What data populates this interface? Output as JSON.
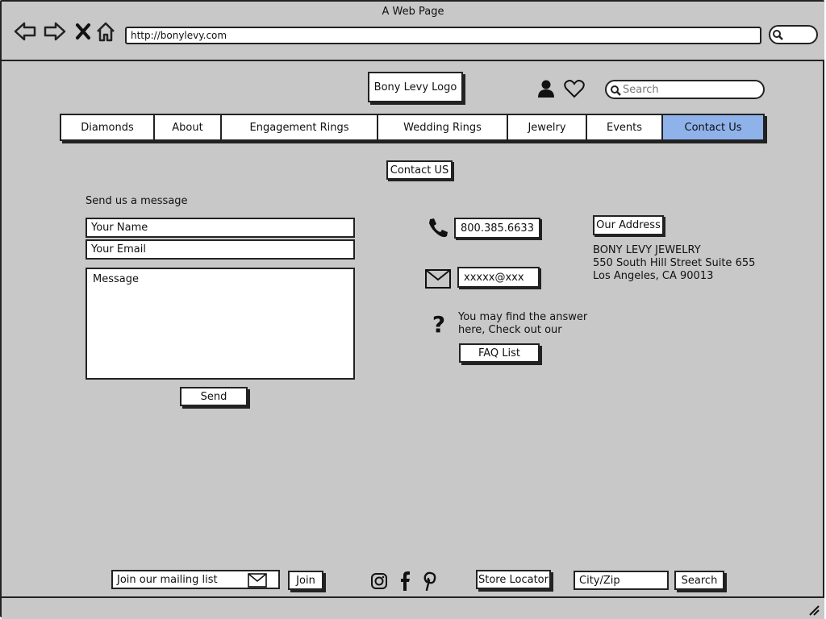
{
  "window": {
    "title": "A Web Page"
  },
  "browser": {
    "url": "http://bonylevy.com"
  },
  "header": {
    "logo": "Bony Levy Logo",
    "search_placeholder": "Search"
  },
  "nav": {
    "items": [
      {
        "label": "Diamonds",
        "active": false
      },
      {
        "label": "About",
        "active": false
      },
      {
        "label": "Engagement Rings",
        "active": false
      },
      {
        "label": "Wedding Rings",
        "active": false
      },
      {
        "label": "Jewelry",
        "active": false
      },
      {
        "label": "Events",
        "active": false
      },
      {
        "label": "Contact Us",
        "active": true
      }
    ],
    "active_color": "#8fb2ea"
  },
  "contact": {
    "title": "Contact US",
    "form": {
      "heading": "Send us a message",
      "name_placeholder": "Your Name",
      "email_placeholder": "Your Email",
      "message_placeholder": "Message",
      "send_label": "Send"
    },
    "phone": "800.385.6633",
    "email": "xxxxx@xxx",
    "faq": {
      "line1": "You may find the answer",
      "line2": "here, Check out our",
      "button": "FAQ List"
    },
    "address": {
      "title": "Our Address",
      "line1": "BONY LEVY JEWELRY",
      "line2": "550 South Hill Street Suite 655",
      "line3": "Los Angeles, CA 90013"
    }
  },
  "footer": {
    "mailing_placeholder": "Join our mailing list",
    "join_label": "Join",
    "store_locator": "Store Locator",
    "cityzip_placeholder": "City/Zip",
    "search_label": "Search"
  }
}
